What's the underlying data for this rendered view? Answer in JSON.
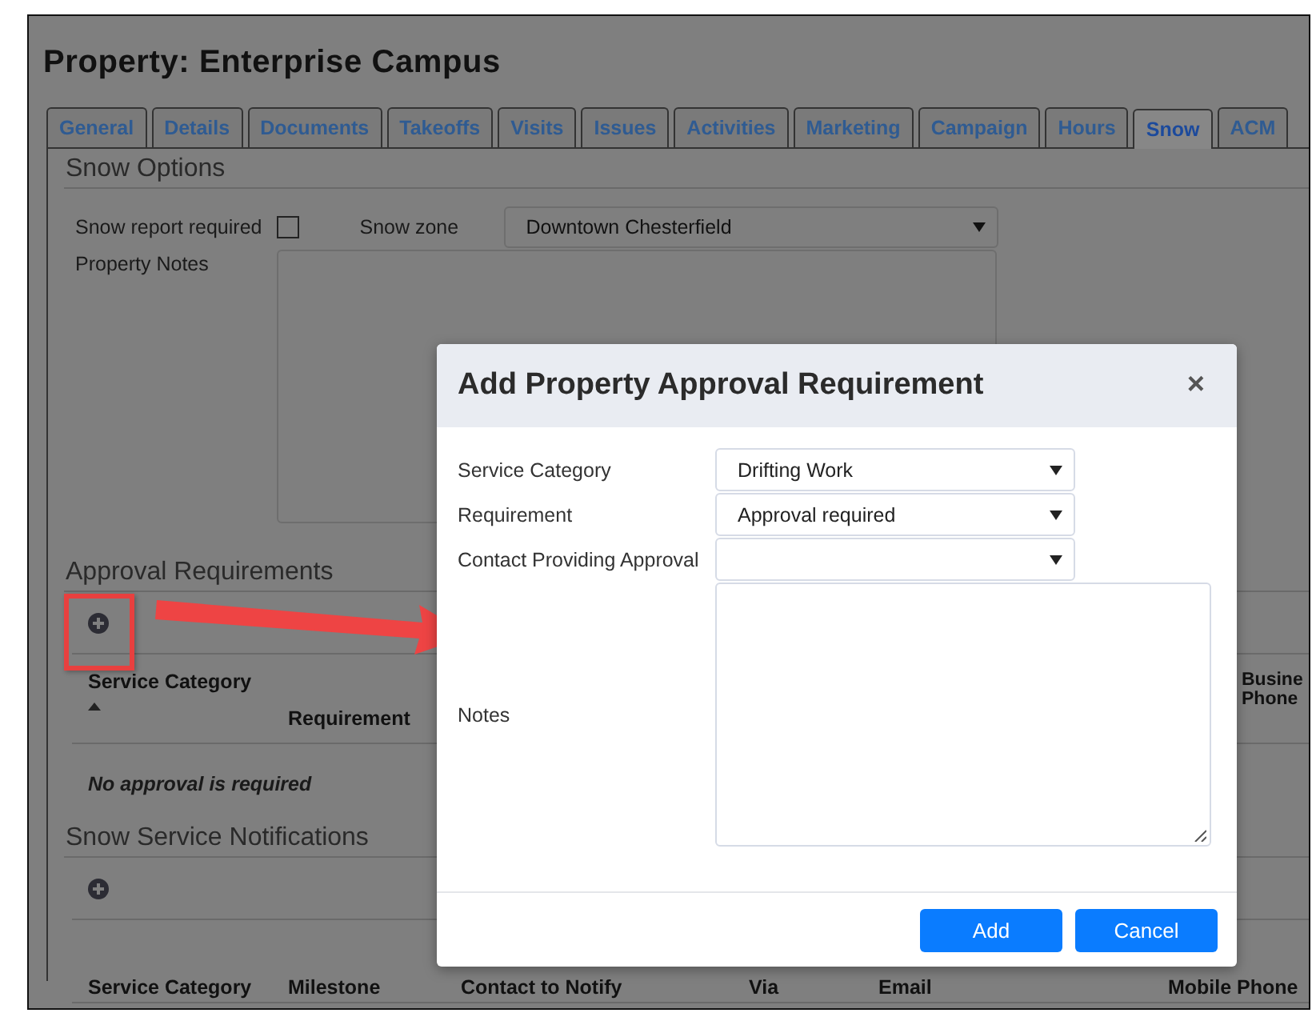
{
  "page": {
    "title": "Property: Enterprise Campus"
  },
  "tabs": [
    {
      "label": "General",
      "selected": false
    },
    {
      "label": "Details",
      "selected": false
    },
    {
      "label": "Documents",
      "selected": false
    },
    {
      "label": "Takeoffs",
      "selected": false
    },
    {
      "label": "Visits",
      "selected": false
    },
    {
      "label": "Issues",
      "selected": false
    },
    {
      "label": "Activities",
      "selected": false
    },
    {
      "label": "Marketing",
      "selected": false
    },
    {
      "label": "Campaign",
      "selected": false
    },
    {
      "label": "Hours",
      "selected": false
    },
    {
      "label": "Snow",
      "selected": true
    },
    {
      "label": "ACM",
      "selected": false
    }
  ],
  "snow_options": {
    "heading": "Snow Options",
    "snow_report_required": {
      "label": "Snow report required",
      "checked": false
    },
    "snow_zone": {
      "label": "Snow zone",
      "value": "Downtown Chesterfield"
    },
    "property_notes": {
      "label": "Property Notes"
    }
  },
  "approval_requirements": {
    "heading": "Approval Requirements",
    "columns": [
      {
        "label": "Service Category",
        "sorted": true
      },
      {
        "label": "Requirement",
        "sorted": false
      },
      {
        "label": "Busine Phone",
        "sorted": false
      }
    ],
    "empty_message": "No approval is required"
  },
  "snow_service_notifications": {
    "heading": "Snow Service Notifications",
    "columns": [
      {
        "label": "Service Category"
      },
      {
        "label": "Milestone"
      },
      {
        "label": "Contact to Notify"
      },
      {
        "label": "Via"
      },
      {
        "label": "Email"
      },
      {
        "label": "Mobile Phone"
      }
    ]
  },
  "dialog": {
    "title": "Add Property Approval Requirement",
    "close": "×",
    "fields": [
      {
        "label": "Service Category",
        "kind": "select",
        "value": "Drifting Work"
      },
      {
        "label": "Requirement",
        "kind": "select",
        "value": "Approval required"
      },
      {
        "label": "Contact Providing Approval",
        "kind": "select"
      },
      {
        "label": "Notes",
        "kind": "textarea"
      }
    ],
    "buttons": [
      "Add",
      "Cancel"
    ]
  }
}
